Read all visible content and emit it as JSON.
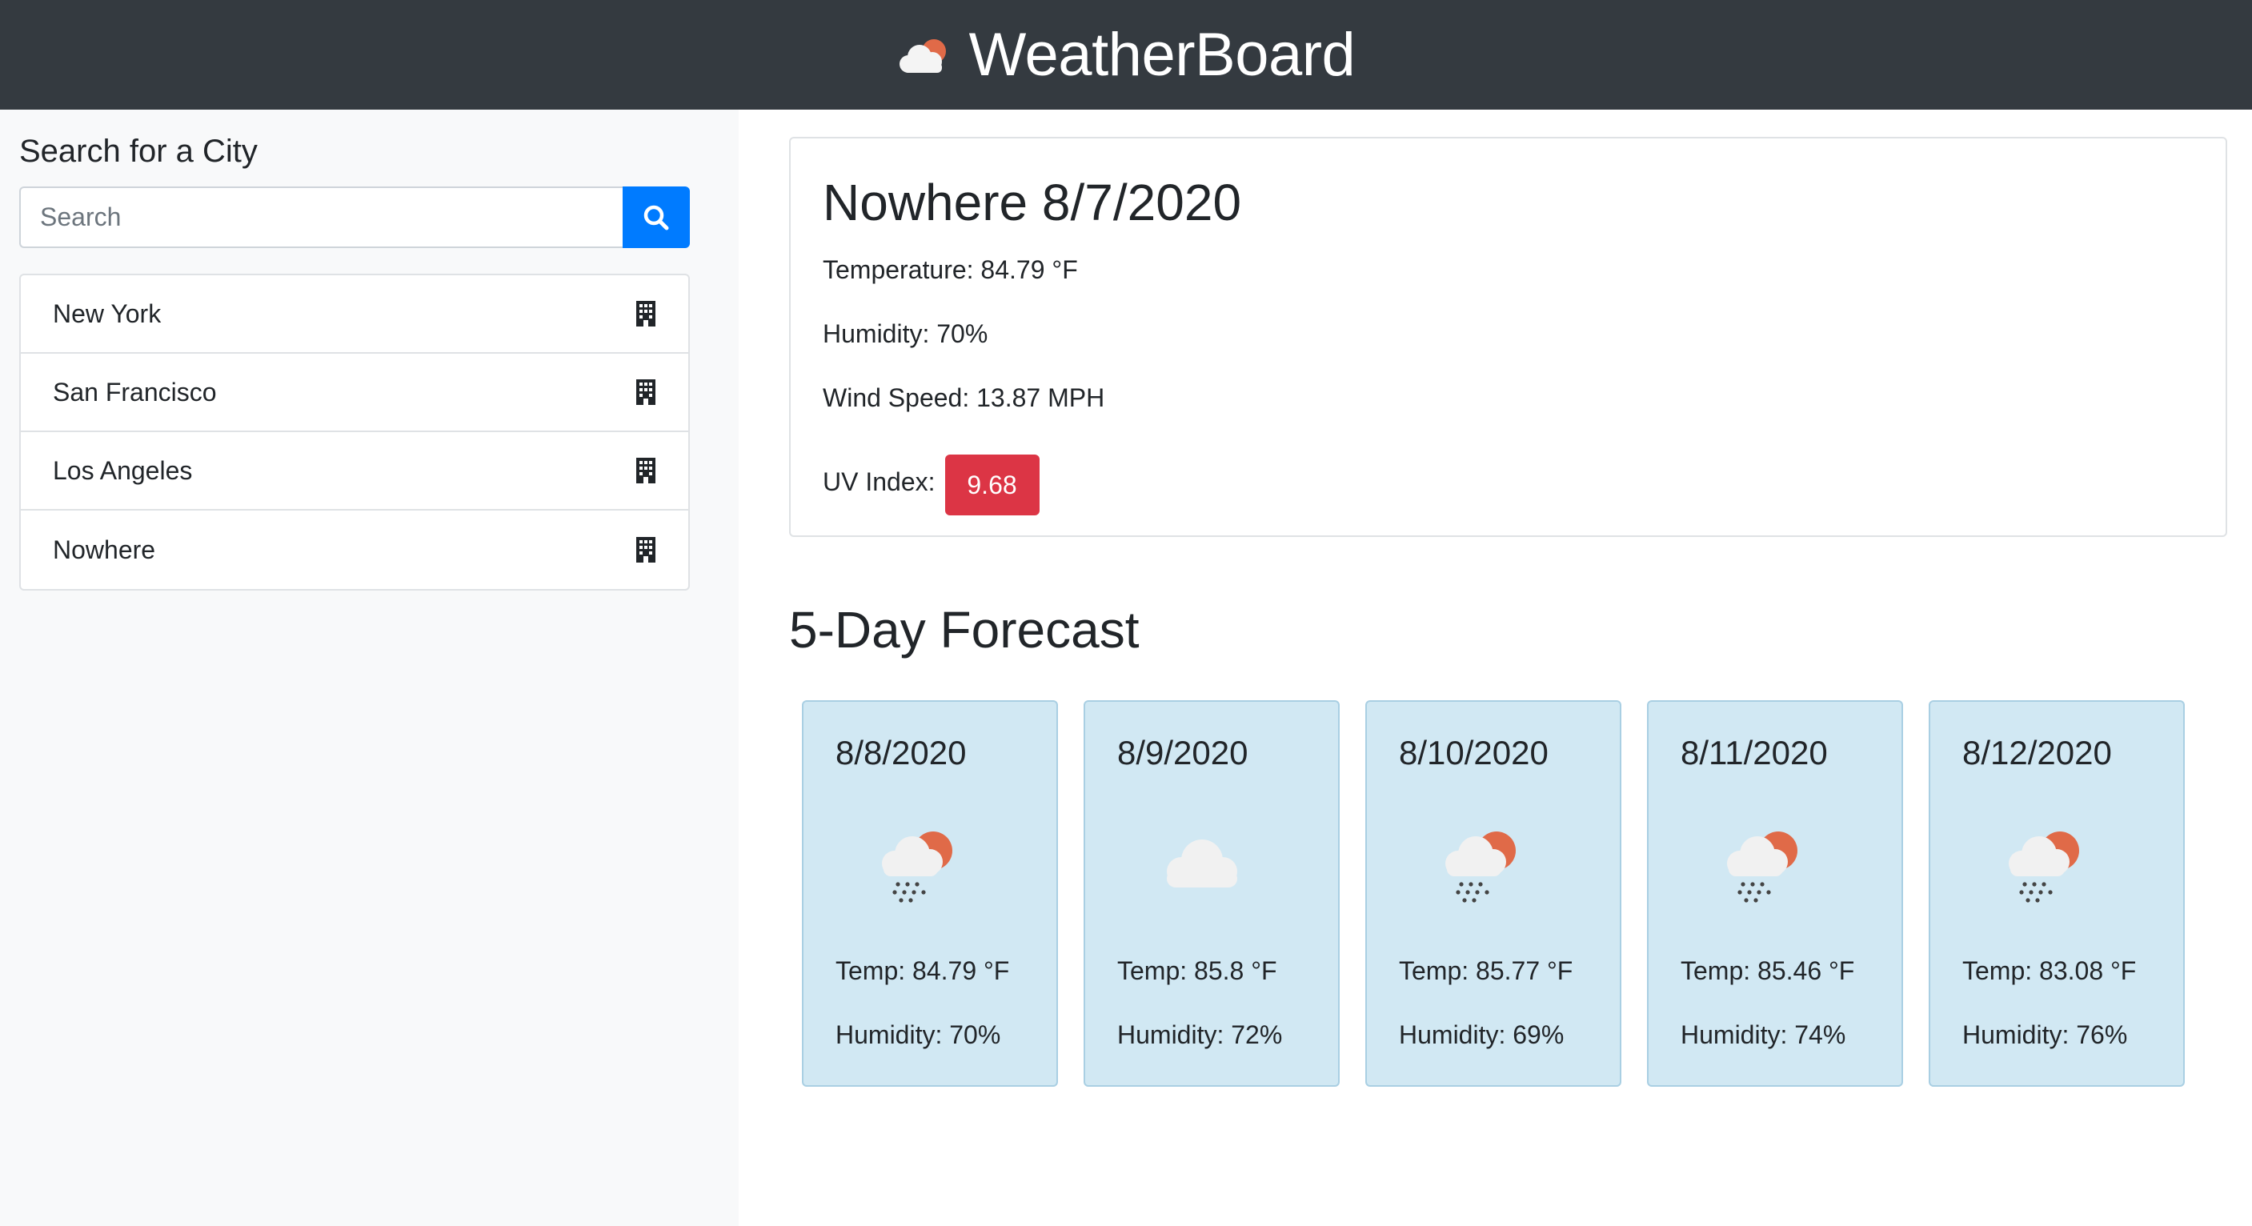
{
  "header": {
    "title": "WeatherBoard",
    "logo_icon": "cloud-sun-icon"
  },
  "sidebar": {
    "heading": "Search for a City",
    "search": {
      "placeholder": "Search",
      "value": "",
      "button_icon": "search-icon"
    },
    "cities": [
      {
        "name": "New York",
        "icon": "building-icon"
      },
      {
        "name": "San Francisco",
        "icon": "building-icon"
      },
      {
        "name": "Los Angeles",
        "icon": "building-icon"
      },
      {
        "name": "Nowhere",
        "icon": "building-icon"
      }
    ]
  },
  "current": {
    "title": "Nowhere 8/7/2020",
    "temperature": "Temperature: 84.79 °F",
    "humidity": "Humidity: 70%",
    "wind": "Wind Speed: 13.87 MPH",
    "uv_label": "UV Index:",
    "uv_value": "9.68",
    "uv_color": "#dc3545"
  },
  "forecast": {
    "heading": "5-Day Forecast",
    "days": [
      {
        "date": "8/8/2020",
        "icon": "rain-sun-icon",
        "temp": "Temp: 84.79 °F",
        "humidity": "Humidity: 70%"
      },
      {
        "date": "8/9/2020",
        "icon": "cloud-icon",
        "temp": "Temp: 85.8 °F",
        "humidity": "Humidity: 72%"
      },
      {
        "date": "8/10/2020",
        "icon": "rain-sun-icon",
        "temp": "Temp: 85.77 °F",
        "humidity": "Humidity: 69%"
      },
      {
        "date": "8/11/2020",
        "icon": "rain-sun-icon",
        "temp": "Temp: 85.46 °F",
        "humidity": "Humidity: 74%"
      },
      {
        "date": "8/12/2020",
        "icon": "rain-sun-icon",
        "temp": "Temp: 83.08 °F",
        "humidity": "Humidity: 76%"
      }
    ]
  },
  "colors": {
    "navbar": "#343a40",
    "primary": "#007bff",
    "danger": "#dc3545",
    "forecast_card": "#d1e8f3",
    "sun": "#e06a48",
    "cloud": "#f1f1f1"
  }
}
